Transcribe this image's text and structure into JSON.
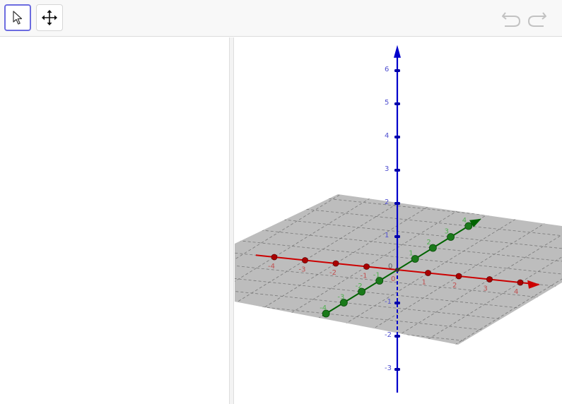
{
  "toolbar": {
    "tools": [
      {
        "name": "Move",
        "icon": "cursor-arrow-icon",
        "selected": true
      },
      {
        "name": "Move Graphics View",
        "icon": "move-cross-arrows-icon",
        "selected": false
      }
    ],
    "undo_icon": "undo-arrow-icon",
    "redo_icon": "redo-arrow-icon"
  },
  "view3d": {
    "colors": {
      "x_axis": "#cc0000",
      "y_axis": "#006400",
      "z_axis": "#0000cc",
      "plane": "#bdbdbd",
      "grid": "#777777",
      "selection": "#6c6ce0"
    },
    "origin_label": "0",
    "x_ticks": [
      "-4",
      "-3",
      "-2",
      "-1",
      "0",
      "1",
      "2",
      "3",
      "4"
    ],
    "y_ticks": [
      "-4",
      "-3",
      "-2",
      "-1",
      "1",
      "2",
      "3",
      "4"
    ],
    "z_ticks": [
      "-3",
      "-2",
      "-1",
      "1",
      "2",
      "3",
      "4",
      "5",
      "6"
    ]
  }
}
